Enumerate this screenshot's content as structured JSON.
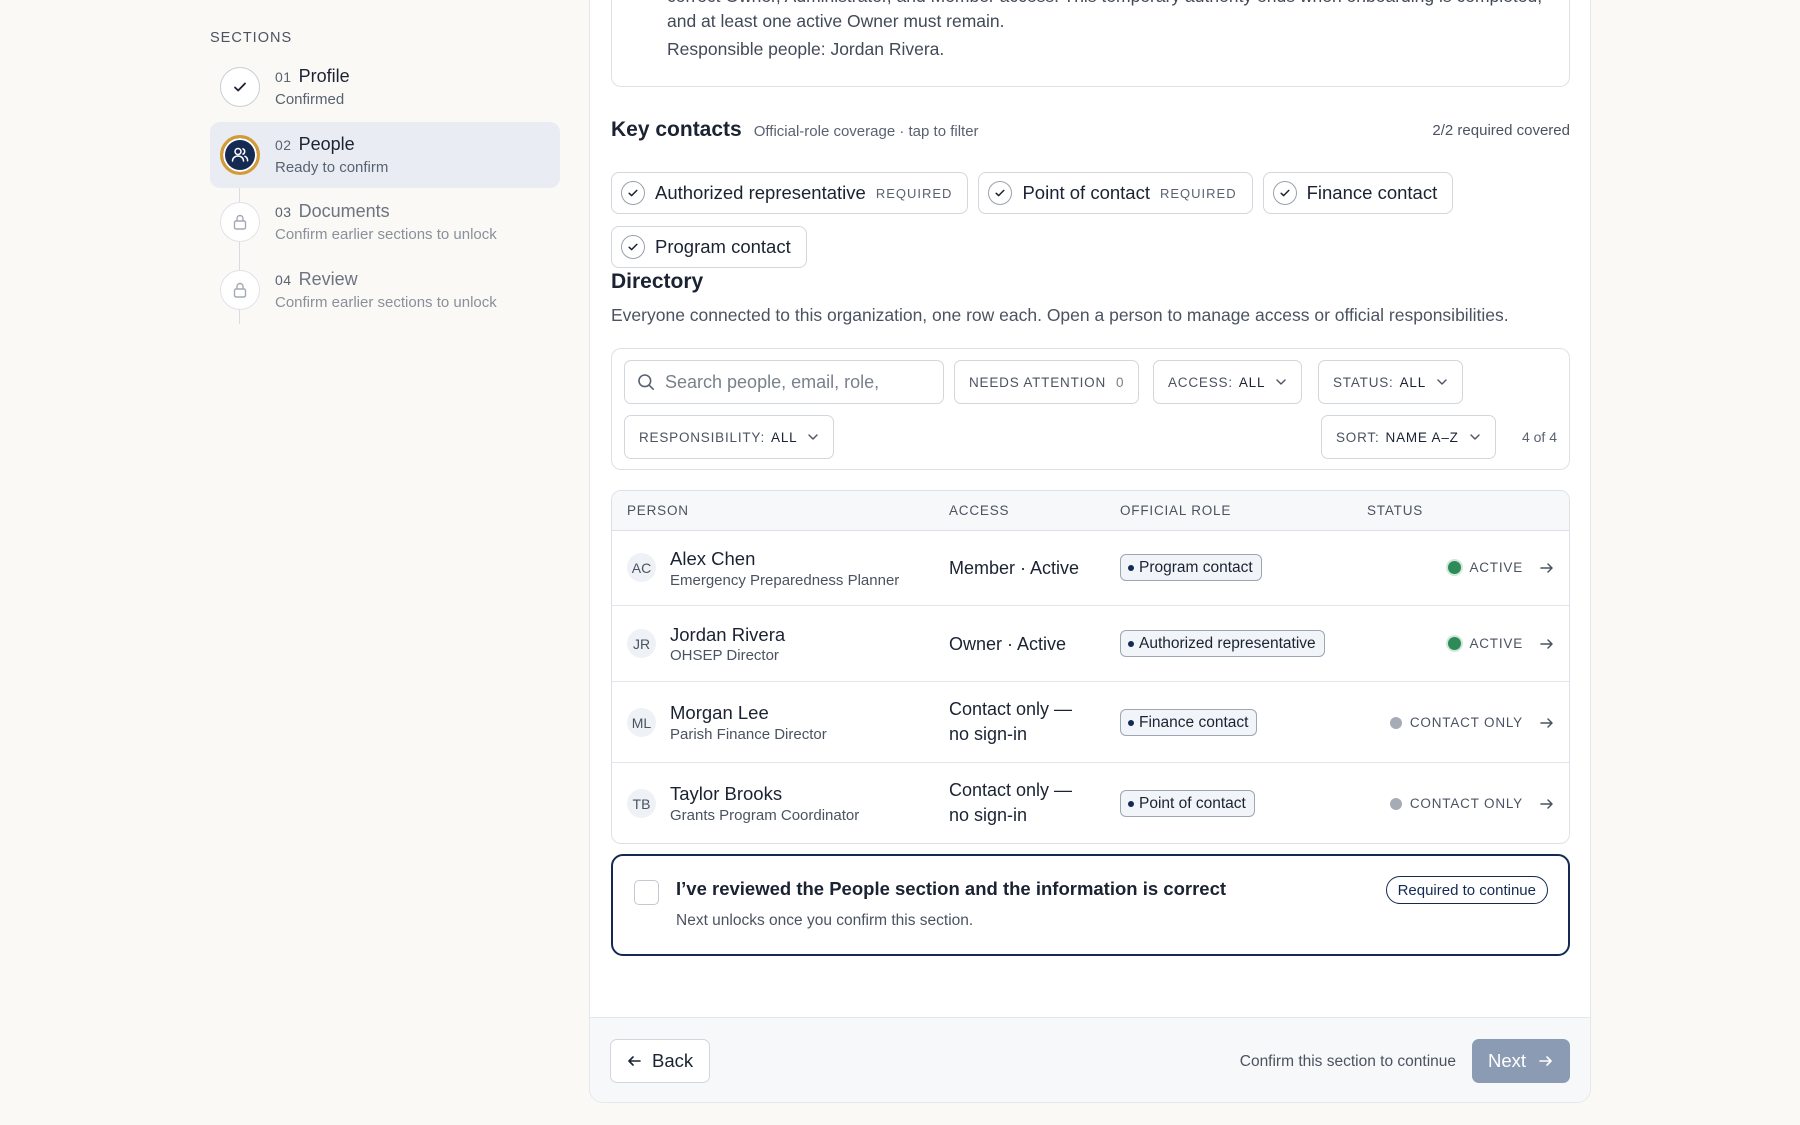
{
  "sidebar": {
    "heading": "SECTIONS",
    "steps": [
      {
        "num": "01",
        "title": "Profile",
        "sub": "Confirmed",
        "state": "done"
      },
      {
        "num": "02",
        "title": "People",
        "sub": "Ready to confirm",
        "state": "active"
      },
      {
        "num": "03",
        "title": "Documents",
        "sub": "Confirm earlier sections to unlock",
        "state": "locked"
      },
      {
        "num": "04",
        "title": "Review",
        "sub": "Confirm earlier sections to unlock",
        "state": "locked"
      }
    ]
  },
  "info": {
    "text": "While this imported organization is being set up, any active Owner or Administrator completing onboarding can correct Owner, Administrator, and Member access. This temporary authority ends when onboarding is completed, and at least one active Owner must remain.",
    "responsible": "Responsible people: Jordan Rivera."
  },
  "key_contacts": {
    "title": "Key contacts",
    "hint": "Official-role coverage · tap to filter",
    "count": "2/2 required covered",
    "chips": [
      {
        "label": "Authorized representative",
        "req": "REQUIRED"
      },
      {
        "label": "Point of contact",
        "req": "REQUIRED"
      },
      {
        "label": "Finance contact",
        "req": ""
      },
      {
        "label": "Program contact",
        "req": ""
      }
    ]
  },
  "directory": {
    "title": "Directory",
    "desc": "Everyone connected to this organization, one row each. Open a person to manage access or official responsibilities."
  },
  "filters": {
    "search_placeholder": "Search people, email, role,",
    "needs_attention_label": "NEEDS ATTENTION",
    "needs_attention_count": "0",
    "access_label": "ACCESS:",
    "access_value": "ALL",
    "status_label": "STATUS:",
    "status_value": "ALL",
    "responsibility_label": "RESPONSIBILITY:",
    "responsibility_value": "ALL",
    "sort_label": "SORT:",
    "sort_value": "NAME A–Z",
    "result_count": "4 of 4"
  },
  "table": {
    "headers": {
      "person": "PERSON",
      "access": "ACCESS",
      "role": "OFFICIAL ROLE",
      "status": "STATUS"
    },
    "rows": [
      {
        "initials": "AC",
        "name": "Alex Chen",
        "title": "Emergency Preparedness Planner",
        "access": "Member · Active",
        "role": "Program contact",
        "status": "ACTIVE",
        "status_type": "active"
      },
      {
        "initials": "JR",
        "name": "Jordan Rivera",
        "title": "OHSEP Director",
        "access": "Owner · Active",
        "role": "Authorized representative",
        "status": "ACTIVE",
        "status_type": "active"
      },
      {
        "initials": "ML",
        "name": "Morgan Lee",
        "title": "Parish Finance Director",
        "access": "Contact only —\nno sign-in",
        "role": "Finance contact",
        "status": "CONTACT ONLY",
        "status_type": "contact"
      },
      {
        "initials": "TB",
        "name": "Taylor Brooks",
        "title": "Grants Program Coordinator",
        "access": "Contact only —\nno sign-in",
        "role": "Point of contact",
        "status": "CONTACT ONLY",
        "status_type": "contact"
      }
    ]
  },
  "confirm": {
    "title": "I’ve reviewed the People section and the information is correct",
    "sub": "Next unlocks once you confirm this section.",
    "pill": "Required to continue"
  },
  "footer": {
    "back": "Back",
    "hint": "Confirm this section to continue",
    "next": "Next"
  },
  "colors": {
    "navy": "#142a52",
    "gold": "#d69a34",
    "active_green": "#2e8b57",
    "next_disabled": "#8b9bb4"
  }
}
